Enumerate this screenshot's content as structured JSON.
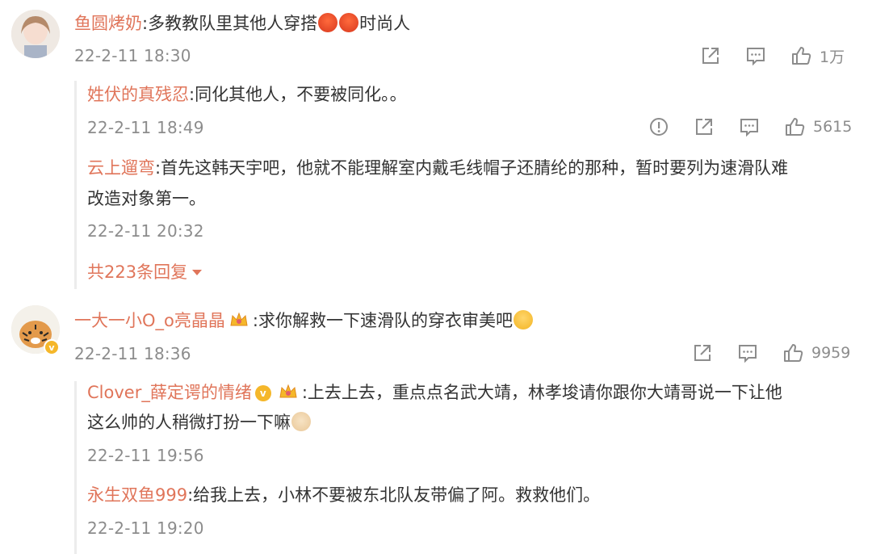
{
  "comments": [
    {
      "author": "鱼圆烤奶",
      "sep": ":",
      "text_a": "多教教队里其他人穿搭",
      "text_b": "时尚人",
      "time": "22-2-11 18:30",
      "likes": "1万",
      "replies": [
        {
          "author": "姓伏的真残忍",
          "sep": ":",
          "text": "同化其他人，不要被同化。。",
          "time": "22-2-11 18:49",
          "likes": "5615"
        },
        {
          "author": "云上遛弯",
          "sep": ":",
          "text_line1": "首先这韩天宇吧，他就不能理解室内戴毛线帽子还腈纶的那种，暂时要列为速滑队难",
          "text_line2": "改造对象第一。",
          "time": "22-2-11 20:32"
        }
      ],
      "more_replies": "共223条回复"
    },
    {
      "author": "一大一小O_o亮晶晶",
      "sep": ":",
      "text": "求你解救一下速滑队的穿衣审美吧",
      "time": "22-2-11 18:36",
      "likes": "9959",
      "replies": [
        {
          "author": "Clover_薛定谔的情绪",
          "sep": ":",
          "text_line1": "上去上去，重点点名武大靖，林孝埈请你跟你大靖哥说一下让他",
          "text_line2": "这么帅的人稍微打扮一下嘛",
          "time": "22-2-11 19:56"
        },
        {
          "author": "永生双鱼999",
          "sep": ":",
          "text": "给我上去，小林不要被东北队友带偏了阿。救救他们。",
          "time": "22-2-11 19:20"
        }
      ]
    }
  ],
  "icons": {
    "share": "share-icon",
    "comment": "comment-icon",
    "like": "thumbs-up-icon",
    "report": "report-icon",
    "emoji_angry": "angry-face-emoji",
    "emoji_cry": "crying-face-emoji",
    "emoji_dog": "doge-emoji",
    "crown": "crown-badge-icon",
    "verified": "verified-badge-icon"
  },
  "colors": {
    "name": "#e0755a",
    "text": "#333333",
    "meta": "#8c8c8c",
    "badge": "#f5b72a"
  }
}
